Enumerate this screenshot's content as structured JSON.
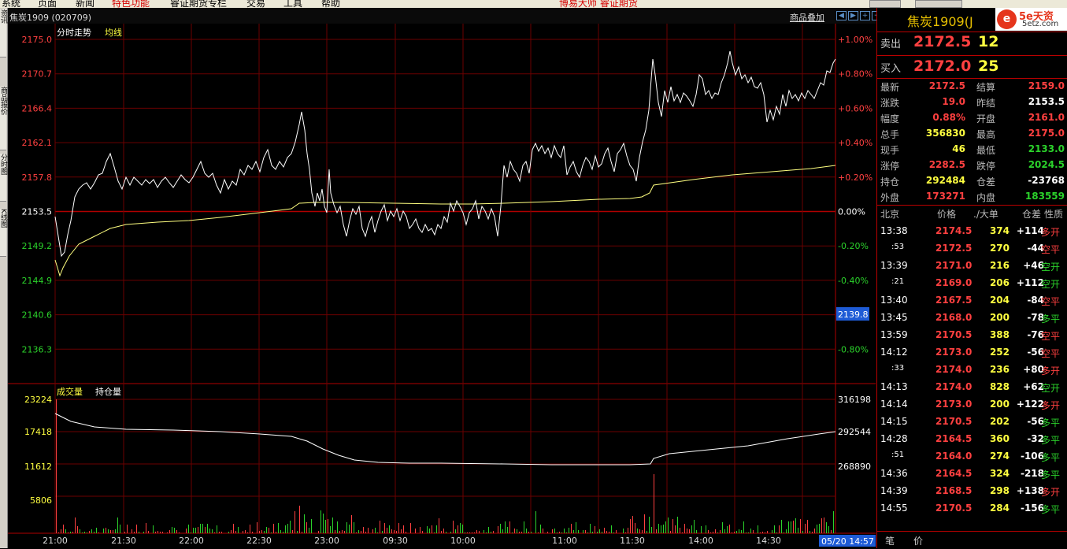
{
  "menubar": {
    "items": [
      "系统",
      "页面",
      "新闻",
      "特色功能",
      "睿证期货专栏",
      "交易",
      "工具",
      "帮助"
    ],
    "brand": "博易大师 睿证期货"
  },
  "left_tabs": [
    "资讯",
    "商品报价",
    "分时图",
    "K线图"
  ],
  "chart_header": {
    "title": "焦炭1909 (020709)",
    "overlay_button": "商品叠加"
  },
  "price_pane": {
    "label_intraday": "分时走势",
    "label_avg": "均线",
    "y_labels": [
      "2175.0",
      "2170.7",
      "2166.4",
      "2162.1",
      "2157.8",
      "2153.5",
      "2149.2",
      "2144.9",
      "2140.6",
      "2136.3"
    ],
    "pct_labels": [
      "+1.00%",
      "+0.80%",
      "+0.60%",
      "+0.40%",
      "+0.20%",
      "0.00%",
      "-0.20%",
      "-0.40%",
      "-0.60%",
      "-0.80%"
    ],
    "cursor_price": "2139.8",
    "colors": {
      "price_line": "#ffffff",
      "avg_line": "#ffff80",
      "grid": "#8b0000",
      "up": "#ff4040",
      "down": "#2bd22b"
    }
  },
  "volume_pane": {
    "label_volume": "成交量",
    "label_oi": "持仓量",
    "vol_labels": [
      "23224",
      "17418",
      "11612",
      "5806"
    ],
    "oi_labels": [
      "316198",
      "292544",
      "268890"
    ]
  },
  "time_axis": {
    "labels": [
      "21:00",
      "21:30",
      "22:00",
      "22:30",
      "23:00",
      "09:30",
      "10:00",
      "11:00",
      "11:30",
      "14:00",
      "14:30"
    ],
    "date_badge": "05/20 14:57"
  },
  "quote_panel": {
    "title": "焦炭1909(J",
    "logo_icon": "e",
    "logo_main": "5e天资",
    "logo_sub": "5etz.com",
    "sell_label": "卖出",
    "sell_price": "2172.5",
    "sell_vol": "12",
    "buy_label": "买入",
    "buy_price": "2172.0",
    "buy_vol": "25",
    "stats": [
      {
        "l1": "最新",
        "v1": "2172.5",
        "c1": "red",
        "l2": "结算",
        "v2": "2159.0",
        "c2": "red"
      },
      {
        "l1": "涨跌",
        "v1": "19.0",
        "c1": "red",
        "l2": "昨结",
        "v2": "2153.5",
        "c2": "white"
      },
      {
        "l1": "幅度",
        "v1": "0.88%",
        "c1": "red",
        "l2": "开盘",
        "v2": "2161.0",
        "c2": "red"
      },
      {
        "l1": "总手",
        "v1": "356830",
        "c1": "yellow",
        "l2": "最高",
        "v2": "2175.0",
        "c2": "red"
      },
      {
        "l1": "现手",
        "v1": "46",
        "c1": "yellow",
        "l2": "最低",
        "v2": "2133.0",
        "c2": "green"
      },
      {
        "l1": "涨停",
        "v1": "2282.5",
        "c1": "red",
        "l2": "跌停",
        "v2": "2024.5",
        "c2": "green"
      },
      {
        "l1": "持仓",
        "v1": "292484",
        "c1": "yellow",
        "l2": "仓差",
        "v2": "-23768",
        "c2": "white"
      },
      {
        "l1": "外盘",
        "v1": "173271",
        "c1": "red",
        "l2": "内盘",
        "v2": "183559",
        "c2": "green"
      }
    ],
    "ticks_header": {
      "c1": "北京",
      "c2": "价格",
      "c3": "./大单",
      "c4": "仓差",
      "c5": "性质"
    },
    "ticks": [
      {
        "time": "13:38",
        "price": "2174.5",
        "vol": "374",
        "oi": "+114",
        "nature": "多开",
        "pc": "red",
        "nc": "red"
      },
      {
        "time": ":53",
        "price": "2172.5",
        "vol": "270",
        "oi": "-44",
        "nature": "空平",
        "pc": "red",
        "nc": "red"
      },
      {
        "time": "13:39",
        "price": "2171.0",
        "vol": "216",
        "oi": "+46",
        "nature": "空开",
        "pc": "red",
        "nc": "green"
      },
      {
        "time": ":21",
        "price": "2169.0",
        "vol": "206",
        "oi": "+112",
        "nature": "空开",
        "pc": "red",
        "nc": "green"
      },
      {
        "time": "13:40",
        "price": "2167.5",
        "vol": "204",
        "oi": "-84",
        "nature": "空平",
        "pc": "red",
        "nc": "red"
      },
      {
        "time": "13:45",
        "price": "2168.0",
        "vol": "200",
        "oi": "-78",
        "nature": "多平",
        "pc": "red",
        "nc": "green"
      },
      {
        "time": "13:59",
        "price": "2170.5",
        "vol": "388",
        "oi": "-76",
        "nature": "空平",
        "pc": "red",
        "nc": "red"
      },
      {
        "time": "14:12",
        "price": "2173.0",
        "vol": "252",
        "oi": "-56",
        "nature": "空平",
        "pc": "red",
        "nc": "red"
      },
      {
        "time": ":33",
        "price": "2174.0",
        "vol": "236",
        "oi": "+80",
        "nature": "多开",
        "pc": "red",
        "nc": "red"
      },
      {
        "time": "14:13",
        "price": "2174.0",
        "vol": "828",
        "oi": "+62",
        "nature": "空开",
        "pc": "red",
        "nc": "green"
      },
      {
        "time": "14:14",
        "price": "2173.0",
        "vol": "200",
        "oi": "+122",
        "nature": "多开",
        "pc": "red",
        "nc": "red"
      },
      {
        "time": "14:15",
        "price": "2170.5",
        "vol": "202",
        "oi": "-56",
        "nature": "多平",
        "pc": "red",
        "nc": "green"
      },
      {
        "time": "14:28",
        "price": "2164.5",
        "vol": "360",
        "oi": "-32",
        "nature": "多平",
        "pc": "red",
        "nc": "green"
      },
      {
        "time": ":51",
        "price": "2164.0",
        "vol": "274",
        "oi": "-106",
        "nature": "多平",
        "pc": "red",
        "nc": "green"
      },
      {
        "time": "14:36",
        "price": "2164.5",
        "vol": "324",
        "oi": "-218",
        "nature": "多平",
        "pc": "red",
        "nc": "green"
      },
      {
        "time": "14:39",
        "price": "2168.5",
        "vol": "298",
        "oi": "+138",
        "nature": "多开",
        "pc": "red",
        "nc": "red"
      },
      {
        "time": "14:55",
        "price": "2170.5",
        "vol": "284",
        "oi": "-156",
        "nature": "多平",
        "pc": "red",
        "nc": "green"
      }
    ],
    "bottom_tabs": [
      "笔",
      "价"
    ]
  }
}
